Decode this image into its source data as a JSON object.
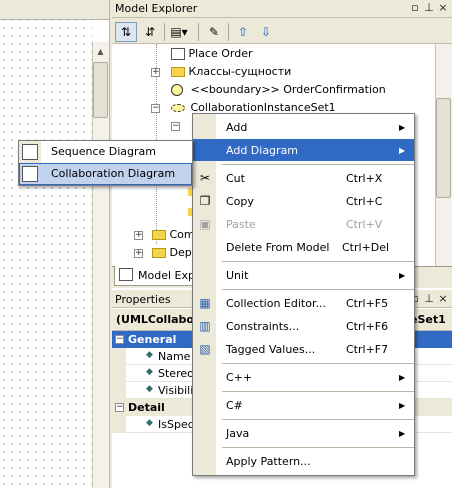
{
  "model_explorer": {
    "title": "Model Explorer",
    "tree": [
      {
        "label": "Place Order",
        "icon": "diagram-icon"
      },
      {
        "label": "Классы-сущности",
        "icon": "folder-icon"
      },
      {
        "label": "<<boundary>> OrderConfirmation",
        "icon": "boundary-icon"
      },
      {
        "label": "CollaborationInstanceSet1",
        "icon": "collaboration-icon"
      },
      {
        "label": "Com",
        "icon": "package-icon"
      },
      {
        "label": "Dep",
        "icon": "package-icon"
      }
    ],
    "tab_label": "Model Explor"
  },
  "properties": {
    "title": "Properties",
    "header_left": "(UMLCollabora",
    "header_right": "eSet1",
    "sections": {
      "general": "General",
      "detail": "Detail"
    },
    "rows": [
      "Name",
      "Stereo",
      "Visibility",
      "IsSpeci"
    ]
  },
  "context_menu": {
    "items": [
      {
        "label": "Add",
        "shortcut": "",
        "submenu": true
      },
      {
        "label": "Add Diagram",
        "shortcut": "",
        "submenu": true,
        "highlighted": true
      },
      {
        "label": "Cut",
        "shortcut": "Ctrl+X"
      },
      {
        "label": "Copy",
        "shortcut": "Ctrl+C"
      },
      {
        "label": "Paste",
        "shortcut": "Ctrl+V",
        "disabled": true
      },
      {
        "label": "Delete From Model",
        "shortcut": "Ctrl+Del"
      },
      {
        "label": "Unit",
        "shortcut": "",
        "submenu": true
      },
      {
        "label": "Collection Editor...",
        "shortcut": "Ctrl+F5"
      },
      {
        "label": "Constraints...",
        "shortcut": "Ctrl+F6"
      },
      {
        "label": "Tagged Values...",
        "shortcut": "Ctrl+F7"
      },
      {
        "label": "C++",
        "shortcut": "",
        "submenu": true
      },
      {
        "label": "C#",
        "shortcut": "",
        "submenu": true
      },
      {
        "label": "Java",
        "shortcut": "",
        "submenu": true
      },
      {
        "label": "Apply Pattern...",
        "shortcut": ""
      }
    ]
  },
  "submenu": {
    "items": [
      {
        "label": "Sequence Diagram"
      },
      {
        "label": "Collaboration Diagram",
        "highlighted": true
      }
    ]
  },
  "colors": {
    "highlight": "#316ac5",
    "chrome": "#ece9d8"
  }
}
